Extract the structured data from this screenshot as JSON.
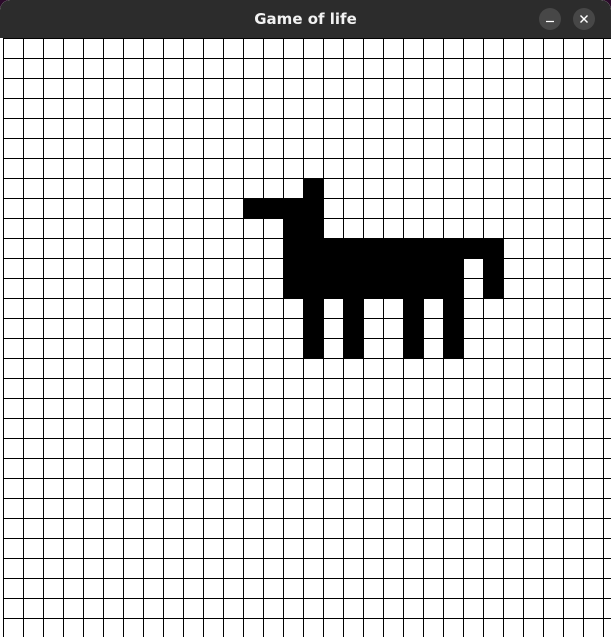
{
  "window": {
    "title": "Game of life"
  },
  "controls": {
    "minimize_icon": "minimize-icon",
    "close_icon": "close-icon"
  },
  "board": {
    "columns": 31,
    "rows": 30,
    "cell_color": "#000000",
    "background_color": "#ffffff",
    "grid_color": "#000000",
    "live_cells": [
      [
        15,
        7
      ],
      [
        12,
        8
      ],
      [
        13,
        8
      ],
      [
        14,
        8
      ],
      [
        15,
        8
      ],
      [
        14,
        9
      ],
      [
        15,
        9
      ],
      [
        14,
        10
      ],
      [
        15,
        10
      ],
      [
        16,
        10
      ],
      [
        17,
        10
      ],
      [
        18,
        10
      ],
      [
        19,
        10
      ],
      [
        20,
        10
      ],
      [
        21,
        10
      ],
      [
        22,
        10
      ],
      [
        23,
        10
      ],
      [
        24,
        10
      ],
      [
        14,
        11
      ],
      [
        15,
        11
      ],
      [
        16,
        11
      ],
      [
        17,
        11
      ],
      [
        18,
        11
      ],
      [
        19,
        11
      ],
      [
        20,
        11
      ],
      [
        21,
        11
      ],
      [
        22,
        11
      ],
      [
        24,
        11
      ],
      [
        14,
        12
      ],
      [
        15,
        12
      ],
      [
        16,
        12
      ],
      [
        17,
        12
      ],
      [
        18,
        12
      ],
      [
        19,
        12
      ],
      [
        20,
        12
      ],
      [
        21,
        12
      ],
      [
        22,
        12
      ],
      [
        24,
        12
      ],
      [
        15,
        13
      ],
      [
        17,
        13
      ],
      [
        20,
        13
      ],
      [
        22,
        13
      ],
      [
        15,
        14
      ],
      [
        17,
        14
      ],
      [
        20,
        14
      ],
      [
        22,
        14
      ],
      [
        15,
        15
      ],
      [
        17,
        15
      ],
      [
        20,
        15
      ],
      [
        22,
        15
      ]
    ]
  }
}
